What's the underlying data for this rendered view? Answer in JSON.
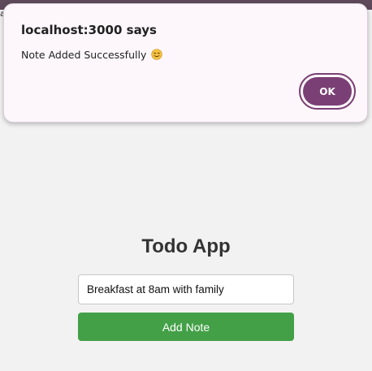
{
  "browser": {
    "partial_text": "a"
  },
  "dialog": {
    "title": "localhost:3000 says",
    "message": "Note Added Successfully",
    "message_emoji_icon": "smiling-face-icon",
    "ok_label": "OK",
    "accent_color": "#7a3f74"
  },
  "app": {
    "title": "Todo App",
    "note_input_value": "Breakfast at 8am with family",
    "add_button_label": "Add Note",
    "add_button_color": "#43a047"
  }
}
